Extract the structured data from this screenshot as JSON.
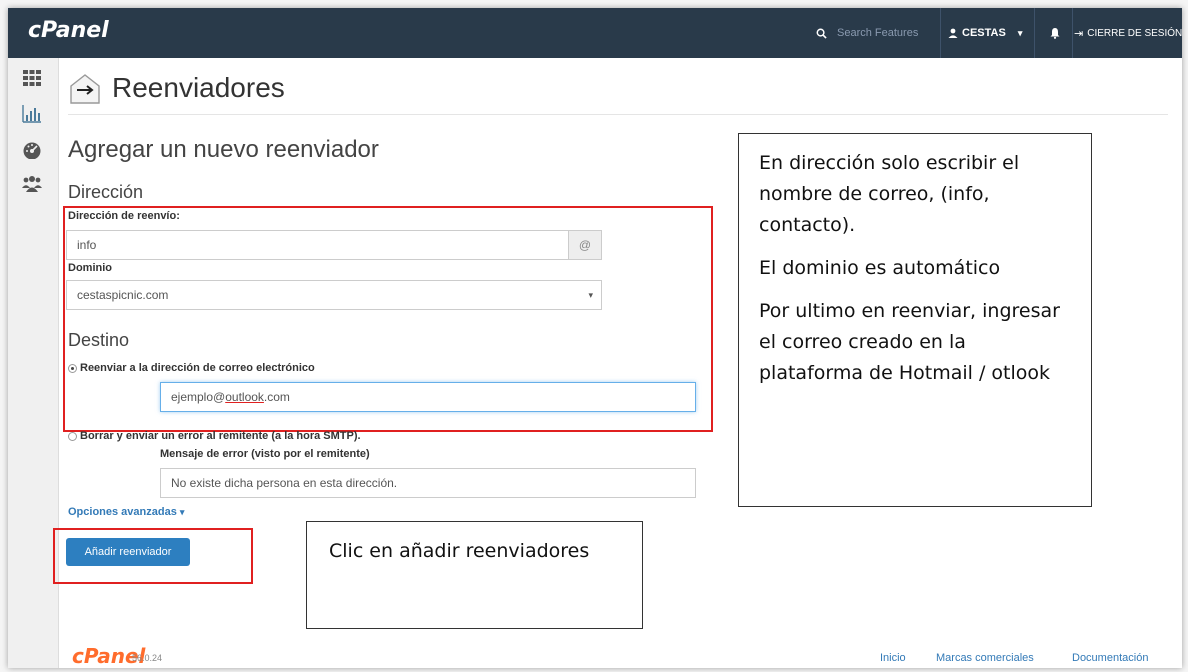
{
  "topbar": {
    "logo": "cPanel",
    "search_placeholder": "Search Features",
    "user_label": "CESTAS",
    "logout_label": "CIERRE DE SESIÓN"
  },
  "page": {
    "title": "Reenviadores",
    "section_title": "Agregar un nuevo reenviador",
    "direccion_heading": "Dirección",
    "forward_address_label": "Dirección de reenvío:",
    "forward_address_value": "info",
    "at_sign": "@",
    "domain_label": "Dominio",
    "domain_value": "cestaspicnic.com",
    "destino_heading": "Destino",
    "forward_to_email_label": "Reenviar a la dirección de correo electrónico",
    "forward_email_value_prefix": "ejemplo@",
    "forward_email_value_underlined": "outlook",
    "forward_email_value_suffix": ".com",
    "discard_label": "Borrar y enviar un error al remitente (a la hora SMTP).",
    "error_message_label": "Mensaje de error (visto por el remitente)",
    "error_message_value": "No existe dicha persona en esta dirección.",
    "advanced_options": "Opciones avanzadas",
    "add_button": "Añadir reenviador"
  },
  "notes": {
    "right_note_line1": "En dirección solo escribir el nombre de correo, (info, contacto).",
    "right_note_line2": "El dominio es automático",
    "right_note_line3": "Por ultimo en reenviar, ingresar el correo creado en la plataforma de Hotmail / otlook",
    "bottom_note": "Clic en añadir reenviadores"
  },
  "footer": {
    "logo": "cPanel",
    "version": "56.0.24",
    "links": [
      "Inicio",
      "Marcas comerciales",
      "Documentación"
    ]
  },
  "colors": {
    "topbar_bg": "#293a4a",
    "highlight_red": "#e02020",
    "button_blue": "#2d7fc0",
    "footer_logo_orange": "#ff6c2c"
  },
  "icons": {
    "search": "search-icon",
    "user": "user-icon",
    "bell": "bell-icon",
    "logout": "logout-icon",
    "grid": "grid-icon",
    "stats": "stats-icon",
    "dashboard": "dashboard-icon",
    "users": "users-icon",
    "forwarder": "forwarder-icon"
  }
}
